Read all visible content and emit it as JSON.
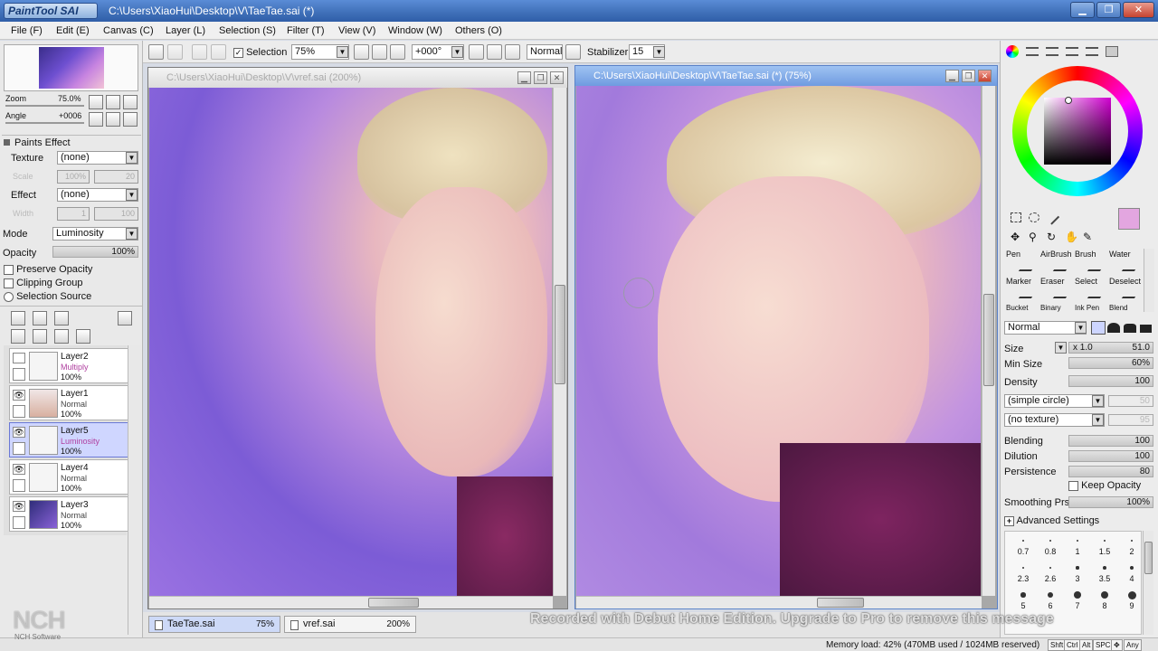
{
  "titlebar": {
    "app_logo_text": "PaintTool SAI",
    "title": "C:\\Users\\XiaoHui\\Desktop\\V\\TaeTae.sai (*)"
  },
  "menu": [
    "File (F)",
    "Edit (E)",
    "Canvas (C)",
    "Layer (L)",
    "Selection (S)",
    "Filter (T)",
    "View (V)",
    "Window (W)",
    "Others (O)"
  ],
  "toolbar": {
    "selection_label": "Selection",
    "zoom": "75%",
    "angle": "+000°",
    "blend_mode": "Normal",
    "stabilizer_label": "Stabilizer",
    "stabilizer_value": "15"
  },
  "navigator": {
    "zoom_label": "Zoom",
    "zoom_value": "75.0%",
    "angle_label": "Angle",
    "angle_value": "+0006"
  },
  "paints_effect": {
    "header": "Paints Effect",
    "texture_label": "Texture",
    "texture_value": "(none)",
    "scale_label": "Scale",
    "scale_value": "100%",
    "scale_num": "20",
    "effect_label": "Effect",
    "effect_value": "(none)",
    "width_label": "Width",
    "width_value": "1",
    "width_num": "100"
  },
  "layer_props": {
    "mode_label": "Mode",
    "mode_value": "Luminosity",
    "opacity_label": "Opacity",
    "opacity_value": "100%",
    "preserve_opacity": "Preserve Opacity",
    "clipping_group": "Clipping Group",
    "selection_source": "Selection Source"
  },
  "layers": [
    {
      "name": "Layer2",
      "mode": "Multiply",
      "opacity": "100%",
      "visible": false,
      "selected": false
    },
    {
      "name": "Layer1",
      "mode": "Normal",
      "opacity": "100%",
      "visible": true,
      "selected": false
    },
    {
      "name": "Layer5",
      "mode": "Luminosity",
      "opacity": "100%",
      "visible": true,
      "selected": true
    },
    {
      "name": "Layer4",
      "mode": "Normal",
      "opacity": "100%",
      "visible": true,
      "selected": false
    },
    {
      "name": "Layer3",
      "mode": "Normal",
      "opacity": "100%",
      "visible": true,
      "selected": false
    }
  ],
  "canvas_windows": [
    {
      "title": "C:\\Users\\XiaoHui\\Desktop\\V\\vref.sai (200%)",
      "active": false
    },
    {
      "title": "C:\\Users\\XiaoHui\\Desktop\\V\\TaeTae.sai (*) (75%)",
      "active": true
    }
  ],
  "tabs": [
    {
      "name": "TaeTae.sai",
      "zoom": "75%",
      "active": true
    },
    {
      "name": "vref.sai",
      "zoom": "200%",
      "active": false
    }
  ],
  "tools": [
    {
      "row": [
        "Pen",
        "AirBrush",
        "Brush",
        "Water"
      ]
    },
    {
      "row": [
        "Marker",
        "Eraser",
        "Select",
        "Deselect"
      ]
    },
    {
      "row": [
        "Bucket",
        "Binary",
        "Ink Pen",
        "Blend"
      ]
    }
  ],
  "brush_settings": {
    "mode": "Normal",
    "size_label": "Size",
    "size_mult": "x 1.0",
    "size_value": "51.0",
    "min_size_label": "Min Size",
    "min_size_value": "60%",
    "density_label": "Density",
    "density_value": "100",
    "shape": "(simple circle)",
    "shape_num": "50",
    "texture": "(no texture)",
    "texture_num": "95",
    "blending_label": "Blending",
    "blending_value": "100",
    "dilution_label": "Dilution",
    "dilution_value": "100",
    "persistence_label": "Persistence",
    "persistence_value": "80",
    "keep_opacity": "Keep Opacity",
    "smoothing_label": "Smoothing Prs",
    "smoothing_value": "100%",
    "advanced": "Advanced Settings"
  },
  "brush_sizes": [
    "0.7",
    "0.8",
    "1",
    "1.5",
    "2",
    "2.3",
    "2.6",
    "3",
    "3.5",
    "4",
    "5",
    "6",
    "7",
    "8",
    "9"
  ],
  "colors": {
    "current": "#e3a6e0",
    "secondary": "#d8d8d8",
    "accent_title": "#3f6fb8"
  },
  "status": {
    "memory": "Memory load: 42% (470MB used / 1024MB reserved)",
    "keys": [
      "Shft",
      "Ctrl",
      "Alt",
      "SPC",
      "Any"
    ]
  },
  "watermark": "Recorded with Debut Home Edition. Upgrade to Pro to remove this message",
  "nch": {
    "logo": "NCH",
    "sub": "NCH Software"
  }
}
